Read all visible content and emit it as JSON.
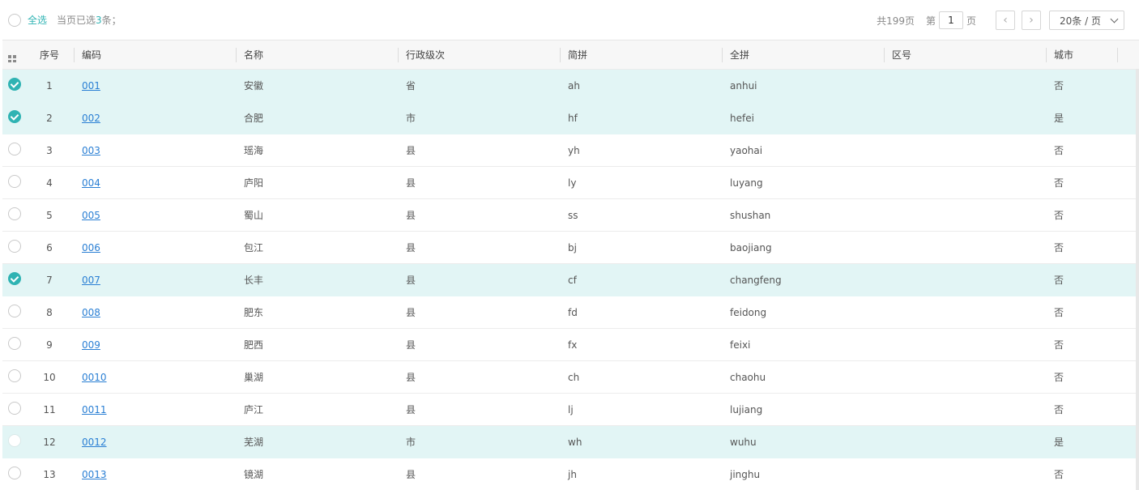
{
  "toolbar": {
    "select_all": "全选",
    "selection_prefix": "当页已选",
    "selection_count": "3",
    "selection_suffix": "条；",
    "total_pages": "共199页",
    "page_prefix": "第",
    "current_page": "1",
    "page_suffix": "页",
    "prev_icon": "chevron-left-icon",
    "next_icon": "chevron-right-icon",
    "page_size": "20条 / 页"
  },
  "columns": {
    "index": "序号",
    "code": "编码",
    "name": "名称",
    "level": "行政级次",
    "abbr": "简拼",
    "full": "全拼",
    "area": "区号",
    "city": "城市"
  },
  "rows": [
    {
      "idx": "1",
      "code": "001",
      "name": "安徽",
      "level": "省",
      "abbr": "ah",
      "full": "anhui",
      "area": "",
      "city": "否",
      "selected": true
    },
    {
      "idx": "2",
      "code": "002",
      "name": "合肥",
      "level": "市",
      "abbr": "hf",
      "full": "hefei",
      "area": "",
      "city": "是",
      "selected": true
    },
    {
      "idx": "3",
      "code": "003",
      "name": "瑶海",
      "level": "县",
      "abbr": "yh",
      "full": "yaohai",
      "area": "",
      "city": "否",
      "selected": false
    },
    {
      "idx": "4",
      "code": "004",
      "name": "庐阳",
      "level": "县",
      "abbr": "ly",
      "full": "luyang",
      "area": "",
      "city": "否",
      "selected": false
    },
    {
      "idx": "5",
      "code": "005",
      "name": "蜀山",
      "level": "县",
      "abbr": "ss",
      "full": "shushan",
      "area": "",
      "city": "否",
      "selected": false
    },
    {
      "idx": "6",
      "code": "006",
      "name": "包江",
      "level": "县",
      "abbr": "bj",
      "full": "baojiang",
      "area": "",
      "city": "否",
      "selected": false
    },
    {
      "idx": "7",
      "code": "007",
      "name": "长丰",
      "level": "县",
      "abbr": "cf",
      "full": "changfeng",
      "area": "",
      "city": "否",
      "selected": true
    },
    {
      "idx": "8",
      "code": "008",
      "name": "肥东",
      "level": "县",
      "abbr": "fd",
      "full": "feidong",
      "area": "",
      "city": "否",
      "selected": false
    },
    {
      "idx": "9",
      "code": "009",
      "name": "肥西",
      "level": "县",
      "abbr": "fx",
      "full": "feixi",
      "area": "",
      "city": "否",
      "selected": false
    },
    {
      "idx": "10",
      "code": "0010",
      "name": "巢湖",
      "level": "县",
      "abbr": "ch",
      "full": "chaohu",
      "area": "",
      "city": "否",
      "selected": false
    },
    {
      "idx": "11",
      "code": "0011",
      "name": "庐江",
      "level": "县",
      "abbr": "lj",
      "full": "lujiang",
      "area": "",
      "city": "否",
      "selected": false
    },
    {
      "idx": "12",
      "code": "0012",
      "name": "芜湖",
      "level": "市",
      "abbr": "wh",
      "full": "wuhu",
      "area": "",
      "city": "是",
      "selected": false,
      "hover": true
    },
    {
      "idx": "13",
      "code": "0013",
      "name": "镜湖",
      "level": "县",
      "abbr": "jh",
      "full": "jinghu",
      "area": "",
      "city": "否",
      "selected": false
    }
  ],
  "colors": {
    "accent": "#2fb3b3",
    "selected_row": "#e2f5f5",
    "link": "#2a7fd4"
  }
}
